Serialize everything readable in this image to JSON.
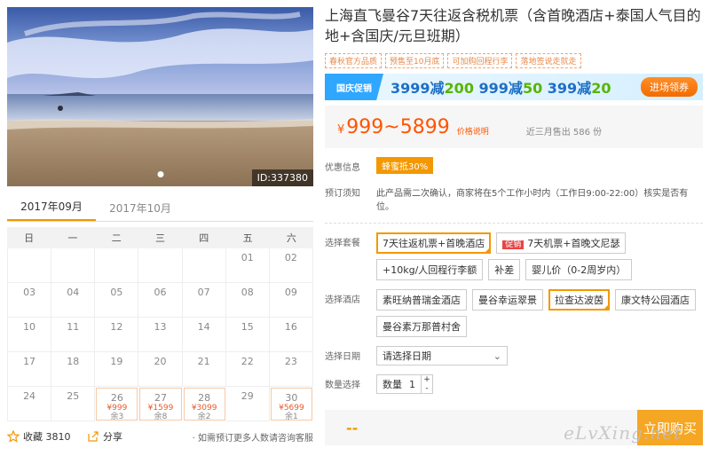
{
  "photo": {
    "id_label": "ID:337380"
  },
  "calendar": {
    "tabs": [
      "2017年09月",
      "2017年10月"
    ],
    "weekdays": [
      "日",
      "一",
      "二",
      "三",
      "四",
      "五",
      "六"
    ],
    "rows": [
      [
        {
          "d": ""
        },
        {
          "d": ""
        },
        {
          "d": ""
        },
        {
          "d": ""
        },
        {
          "d": ""
        },
        {
          "d": "01"
        },
        {
          "d": "02"
        }
      ],
      [
        {
          "d": "03"
        },
        {
          "d": "04"
        },
        {
          "d": "05"
        },
        {
          "d": "06"
        },
        {
          "d": "07"
        },
        {
          "d": "08"
        },
        {
          "d": "09"
        }
      ],
      [
        {
          "d": "10"
        },
        {
          "d": "11"
        },
        {
          "d": "12"
        },
        {
          "d": "13"
        },
        {
          "d": "14"
        },
        {
          "d": "15"
        },
        {
          "d": "16"
        }
      ],
      [
        {
          "d": "17"
        },
        {
          "d": "18"
        },
        {
          "d": "19"
        },
        {
          "d": "20"
        },
        {
          "d": "21"
        },
        {
          "d": "22"
        },
        {
          "d": "23"
        }
      ],
      [
        {
          "d": "24"
        },
        {
          "d": "25"
        },
        {
          "d": "26",
          "p": "¥999",
          "s": "余3"
        },
        {
          "d": "27",
          "p": "¥1599",
          "s": "余8"
        },
        {
          "d": "28",
          "p": "¥3099",
          "s": "余2"
        },
        {
          "d": "29"
        },
        {
          "d": "30",
          "p": "¥5699",
          "s": "余1"
        }
      ]
    ]
  },
  "bottom": {
    "fav": "收藏 3810",
    "share": "分享",
    "tip": "· 如需预订更多人数请咨询客服"
  },
  "product": {
    "title": "上海直飞曼谷7天往返含税机票（含首晚酒店+泰国人气目的地+含国庆/元旦班期）",
    "tags": [
      "春秋官方品质",
      "预售至10月底",
      "可加购回程行李",
      "落地签说走就走"
    ],
    "promo": {
      "badge": "国庆促销",
      "p1a": "3999减",
      "p1b": "200",
      "p2a": " 999减",
      "p2b": "50",
      "p3a": " 399减",
      "p3b": "20",
      "btn": "进场领券"
    },
    "price": {
      "yen": "¥",
      "range": "999~5899",
      "link": "价格说明",
      "sold": "近三月售出 586 份"
    },
    "discount": {
      "label": "优惠信息",
      "badge": "蜂蜜抵30%"
    },
    "notice": {
      "label": "预订须知",
      "text": "此产品需二次确认，商家将在5个工作小时内（工作日9:00-22:00）核实是否有位。"
    },
    "package": {
      "label": "选择套餐",
      "options": [
        {
          "text": "7天往返机票+首晚酒店",
          "selected": true
        },
        {
          "text": "7天机票+首晚文尼瑟",
          "badge": "促销"
        },
        {
          "text": "+10kg/人回程行李额"
        },
        {
          "text": "补差"
        },
        {
          "text": "婴儿价（0-2周岁内）"
        }
      ]
    },
    "hotel": {
      "label": "选择酒店",
      "options": [
        {
          "text": "素旺纳普瑞金酒店"
        },
        {
          "text": "曼谷幸运翠景"
        },
        {
          "text": "拉查达波茵",
          "selected": true
        },
        {
          "text": "康文特公园酒店"
        },
        {
          "text": "曼谷素万那普村舍"
        }
      ]
    },
    "date": {
      "label": "选择日期",
      "value": "请选择日期"
    },
    "quantity": {
      "label": "数量选择",
      "text": "数量",
      "value": "1"
    },
    "buy": {
      "price": "--",
      "btn": "立即购买"
    }
  },
  "watermark": "eLvXing.net"
}
